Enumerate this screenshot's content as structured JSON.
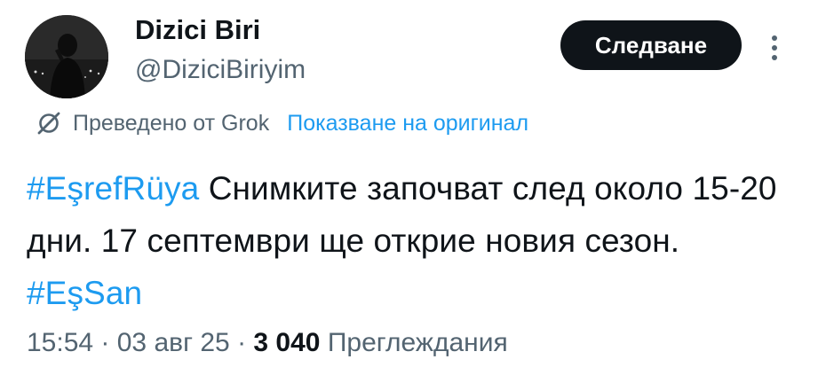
{
  "author": {
    "name": "Dizici Biri",
    "handle": "@DiziciBiriyim"
  },
  "follow_button_label": "Следване",
  "more_icon": "more-vertical-icon",
  "translation": {
    "icon": "grok-icon",
    "translated_by": "Преведено от Grok",
    "show_original_label": "Показване на оригинал"
  },
  "tweet": {
    "hashtag_1": "#EşrefRüya",
    "text_1": " Снимките започват след около 15-20 дни. 17 септември ще открие новия сезон. ",
    "hashtag_2": "#EşSan"
  },
  "meta": {
    "time": "15:54",
    "separator_1": " · ",
    "date": "03 авг 25",
    "separator_2": " · ",
    "views_count": "3 040",
    "views_label": " Преглеждания"
  },
  "colors": {
    "accent": "#1d9bf0",
    "secondary_text": "#536471",
    "primary_text": "#0f1419",
    "button_bg": "#0f1419"
  }
}
